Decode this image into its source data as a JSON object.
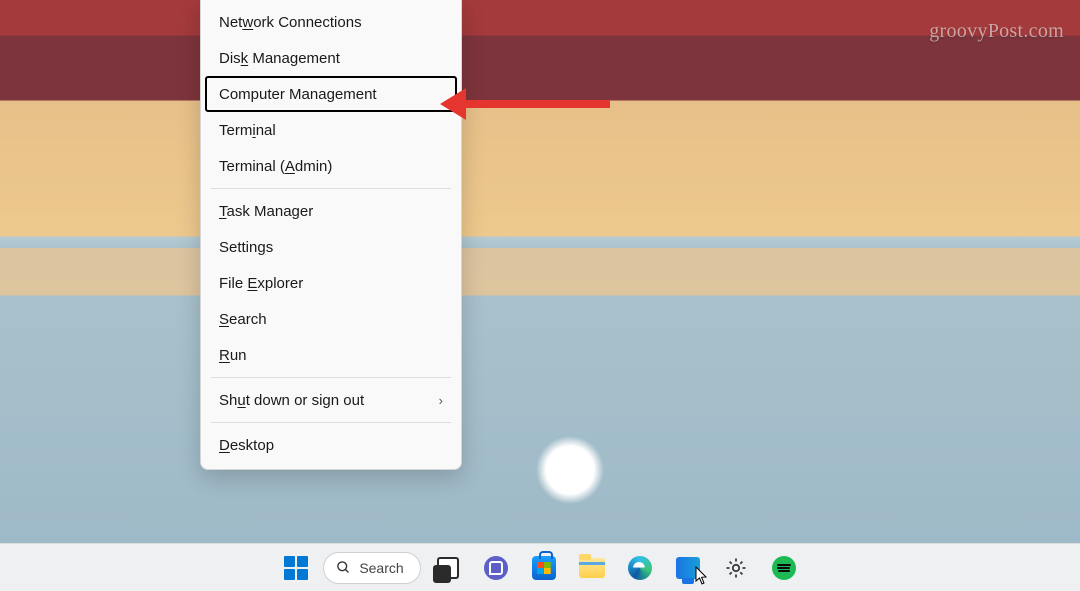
{
  "watermark": "groovyPost.com",
  "menu": {
    "items": [
      {
        "pre": "Net",
        "u": "w",
        "post": "ork Connections",
        "name": "menu-network-connections"
      },
      {
        "pre": "Dis",
        "u": "k",
        "post": " Management",
        "name": "menu-disk-management"
      },
      {
        "pre": "Computer Mana",
        "u": "g",
        "post": "ement",
        "name": "menu-computer-management",
        "highlight": true
      },
      {
        "pre": "Term",
        "u": "i",
        "post": "nal",
        "name": "menu-terminal"
      },
      {
        "pre": "Terminal (",
        "u": "A",
        "post": "dmin)",
        "name": "menu-terminal-admin"
      }
    ],
    "items2": [
      {
        "pre": "",
        "u": "T",
        "post": "ask Manager",
        "name": "menu-task-manager"
      },
      {
        "pre": "Settin",
        "u": "g",
        "post": "s",
        "name": "menu-settings"
      },
      {
        "pre": "File ",
        "u": "E",
        "post": "xplorer",
        "name": "menu-file-explorer"
      },
      {
        "pre": "",
        "u": "S",
        "post": "earch",
        "name": "menu-search"
      },
      {
        "pre": "",
        "u": "R",
        "post": "un",
        "name": "menu-run"
      }
    ],
    "items3": [
      {
        "pre": "Sh",
        "u": "u",
        "post": "t down or sign out",
        "name": "menu-shut-down",
        "submenu": true
      }
    ],
    "items4": [
      {
        "pre": "",
        "u": "D",
        "post": "esktop",
        "name": "menu-desktop"
      }
    ]
  },
  "taskbar": {
    "search_label": "Search",
    "buttons": [
      {
        "name": "start-button",
        "icon": "win-logo"
      },
      {
        "name": "search-button",
        "icon": "search-pill"
      },
      {
        "name": "task-view-button",
        "icon": "taskview"
      },
      {
        "name": "chat-button",
        "icon": "chat-icon"
      },
      {
        "name": "store-button",
        "icon": "store-icon"
      },
      {
        "name": "file-explorer-button",
        "icon": "folder-icon"
      },
      {
        "name": "edge-button",
        "icon": "edge-icon"
      },
      {
        "name": "copilot-button",
        "icon": "copilot-icon"
      },
      {
        "name": "settings-button",
        "icon": "gear-icon"
      },
      {
        "name": "spotify-button",
        "icon": "spotify-icon"
      }
    ]
  }
}
